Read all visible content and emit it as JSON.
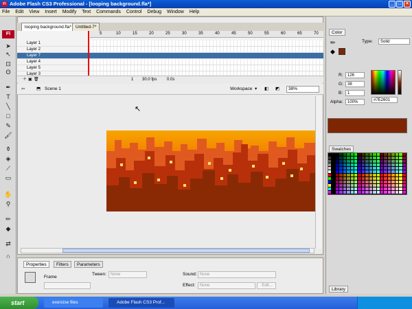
{
  "window": {
    "title": "Adobe Flash CS3 Professional - [looping background.fla*]",
    "app_icon": "Fl"
  },
  "menu": [
    "File",
    "Edit",
    "View",
    "Insert",
    "Modify",
    "Text",
    "Commands",
    "Control",
    "Debug",
    "Window",
    "Help"
  ],
  "tabs": [
    "looping background.fla*",
    "Untitled-7*"
  ],
  "timeline": {
    "ruler": [
      "5",
      "10",
      "15",
      "20",
      "25",
      "30",
      "35",
      "40",
      "45",
      "50",
      "55",
      "60",
      "65",
      "70"
    ],
    "layers": [
      "Layer 1",
      "Layer 2",
      "Layer 7",
      "Layer 4",
      "Layer 5",
      "Layer 3"
    ],
    "selected_layer": "Layer 7",
    "current_frame": "1",
    "fps": "30.0 fps",
    "time": "0.0s"
  },
  "edit_bar": {
    "scene": "Scene 1",
    "workspace": "Workspace",
    "zoom": "38%"
  },
  "properties": {
    "tabs": [
      "Properties",
      "Filters",
      "Parameters"
    ],
    "frame_label": "Frame",
    "tween_label": "Tween:",
    "tween_value": "None",
    "sound_label": "Sound:",
    "sound_value": "None",
    "effect_label": "Effect:",
    "effect_value": "None",
    "edit_label": "Edit..."
  },
  "color_panel": {
    "title": "Color",
    "type_label": "Type:",
    "type_value": "Solid",
    "r_label": "R:",
    "r_value": "126",
    "g_label": "G:",
    "g_value": "38",
    "b_label": "B:",
    "b_value": "1",
    "alpha_label": "Alpha:",
    "alpha_value": "100%",
    "hex_value": "#7E2601",
    "current_color": "#7E2601"
  },
  "swatches_panel": {
    "title": "Swatches"
  },
  "library_panel": {
    "title": "Library"
  },
  "taskbar": {
    "start": "start",
    "items": [
      "exercise files",
      "Adobe Flash CS3 Prof..."
    ]
  }
}
